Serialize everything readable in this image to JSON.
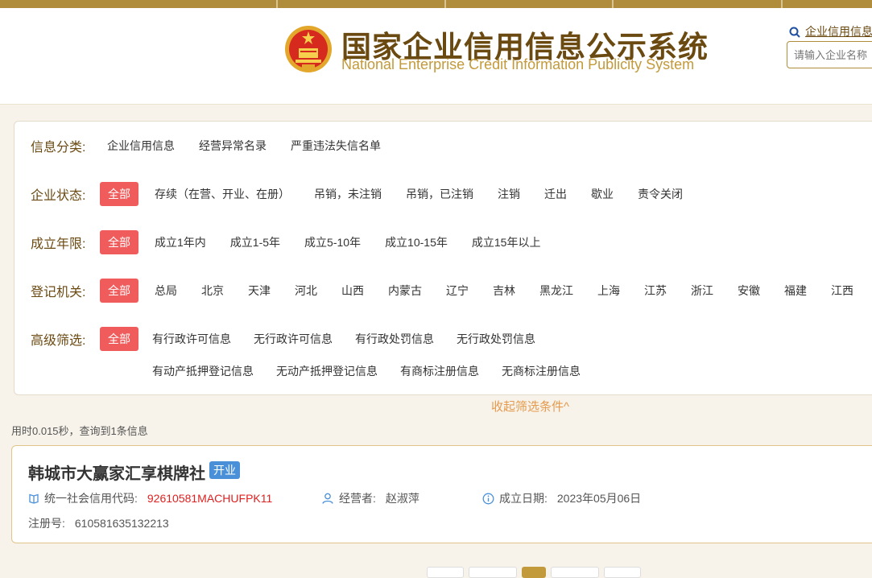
{
  "header": {
    "title_cn": "国家企业信用信息公示系统",
    "title_en": "National Enterprise Credit Information Publicity System",
    "search_link": "企业信用信息",
    "search_placeholder": "请输入企业名称"
  },
  "filters": {
    "category": {
      "label": "信息分类:",
      "options": [
        "企业信用信息",
        "经营异常名录",
        "严重违法失信名单"
      ]
    },
    "status": {
      "label": "企业状态:",
      "selected": "全部",
      "options": [
        "存续（在营、开业、在册）",
        "吊销，未注销",
        "吊销，已注销",
        "注销",
        "迁出",
        "歇业",
        "责令关闭"
      ]
    },
    "years": {
      "label": "成立年限:",
      "selected": "全部",
      "options": [
        "成立1年内",
        "成立1-5年",
        "成立5-10年",
        "成立10-15年",
        "成立15年以上"
      ]
    },
    "authority": {
      "label": "登记机关:",
      "selected": "全部",
      "options": [
        "总局",
        "北京",
        "天津",
        "河北",
        "山西",
        "内蒙古",
        "辽宁",
        "吉林",
        "黑龙江",
        "上海",
        "江苏",
        "浙江",
        "安徽",
        "福建",
        "江西"
      ]
    },
    "advanced": {
      "label": "高级筛选:",
      "selected": "全部",
      "options_row1": [
        "有行政许可信息",
        "无行政许可信息",
        "有行政处罚信息",
        "无行政处罚信息"
      ],
      "options_row2": [
        "有动产抵押登记信息",
        "无动产抵押登记信息",
        "有商标注册信息",
        "无商标注册信息"
      ]
    },
    "collapse_label": "收起筛选条件^"
  },
  "stats_text": "用时0.015秒，查询到1条信息",
  "result": {
    "company_name": "韩城市大赢家汇享棋牌社",
    "status_badge": "开业",
    "credit_code_label": "统一社会信用代码:",
    "credit_code": "92610581MACHUFPK11",
    "operator_label": "经营者:",
    "operator": "赵淑萍",
    "established_label": "成立日期:",
    "established": "2023年05月06日",
    "reg_no_label": "注册号:",
    "reg_no": "610581635132213"
  },
  "colors": {
    "brand_gold": "#b08d3c",
    "title_brown": "#6b4a12",
    "pill_red": "#f05c5c",
    "badge_blue": "#4a90d9",
    "code_red": "#e02020"
  }
}
